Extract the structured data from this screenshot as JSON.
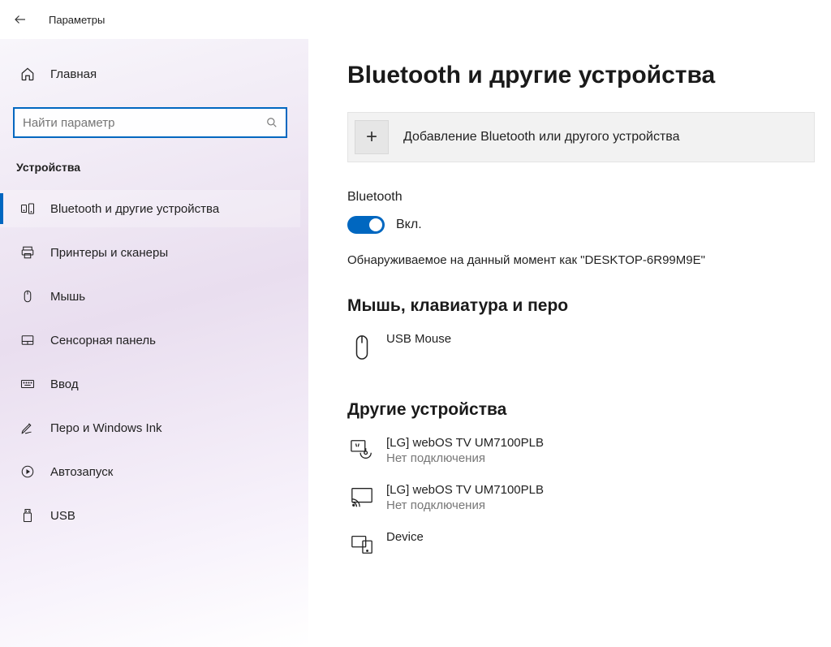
{
  "topbar": {
    "title": "Параметры"
  },
  "sidebar": {
    "home": "Главная",
    "search_placeholder": "Найти параметр",
    "category": "Устройства",
    "items": [
      {
        "label": "Bluetooth и другие устройства",
        "icon": "bluetooth",
        "active": true
      },
      {
        "label": "Принтеры и сканеры",
        "icon": "printer",
        "active": false
      },
      {
        "label": "Мышь",
        "icon": "mouse",
        "active": false
      },
      {
        "label": "Сенсорная панель",
        "icon": "touchpad",
        "active": false
      },
      {
        "label": "Ввод",
        "icon": "keyboard",
        "active": false
      },
      {
        "label": "Перо и Windows Ink",
        "icon": "pen",
        "active": false
      },
      {
        "label": "Автозапуск",
        "icon": "autoplay",
        "active": false
      },
      {
        "label": "USB",
        "icon": "usb",
        "active": false
      }
    ]
  },
  "main": {
    "heading": "Bluetooth и другие устройства",
    "add_device": "Добавление Bluetooth или другого устройства",
    "bt_label": "Bluetooth",
    "toggle_state": "Вкл.",
    "discoverable": "Обнаруживаемое на данный момент как \"DESKTOP-6R99M9E\"",
    "section_mouse": "Мышь, клавиатура и перо",
    "mouse_device": "USB Mouse",
    "section_other": "Другие устройства",
    "others": [
      {
        "name": "[LG] webOS TV UM7100PLB",
        "status": "Нет подключения",
        "icon": "media"
      },
      {
        "name": "[LG] webOS TV UM7100PLB",
        "status": "Нет подключения",
        "icon": "cast"
      },
      {
        "name": "Device",
        "status": "",
        "icon": "multi"
      }
    ]
  }
}
